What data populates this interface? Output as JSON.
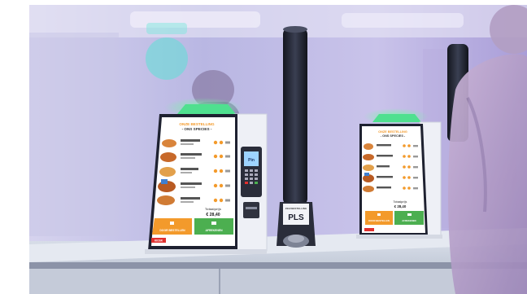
{
  "scene": {
    "description_colors": {
      "background_tint": "#b8a8e8",
      "kiosk_screen_bg": "#ffffff",
      "accent_orange": "#f39a2b",
      "accent_green": "#4caf50",
      "beacon_green": "#37d67a",
      "pole_dark": "#1e2130"
    }
  },
  "kiosk_left": {
    "header_line1": "ONZE BESTELLING",
    "header_line2": "- ONS SPECIES -",
    "total_label": "Totaalprijs",
    "total_value": "€ 28,40",
    "button_left": "DOOR BESTELLEN",
    "button_right": "AFREKENEN",
    "brand": "KIOSK"
  },
  "kiosk_right": {
    "header_line1": "ONZE BESTELLING",
    "header_line2": "- ONS SPECIES -",
    "total_label": "Totaalprijs",
    "total_value": "€ 28,40",
    "button_left": "DOOR BESTELLEN",
    "button_right": "AFREKENEN"
  },
  "terminal": {
    "screen_text": "Pin"
  },
  "pole": {
    "label_small": "ZELFBESTELLING",
    "label_big": "PLS"
  }
}
